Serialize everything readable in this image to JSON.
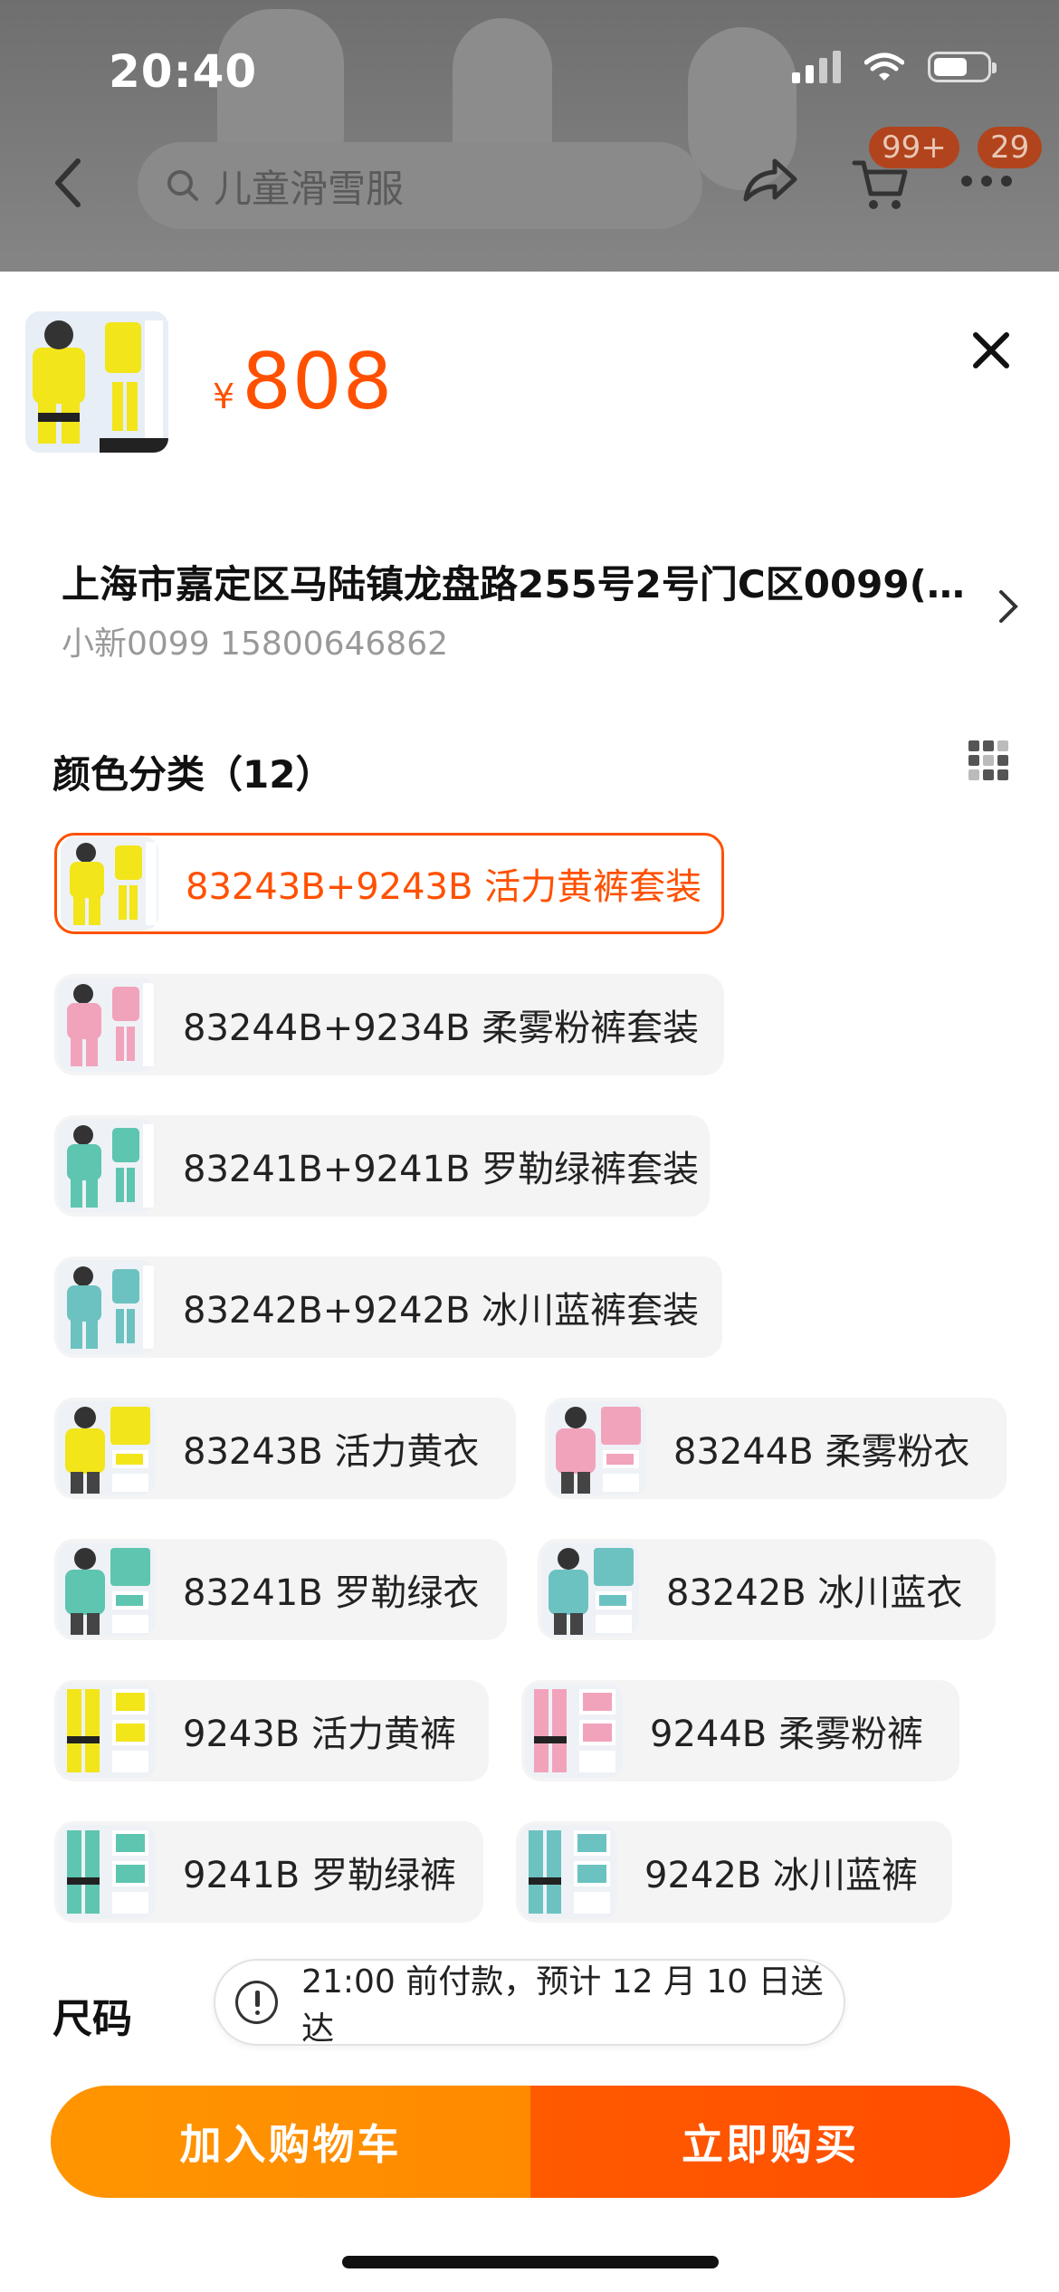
{
  "status_bar": {
    "time": "20:40"
  },
  "nav": {
    "search_placeholder": "儿童滑雪服",
    "cart_badge": "99+",
    "message_badge": "29",
    "icons": [
      "back-icon",
      "search-icon",
      "share-icon",
      "cart-icon",
      "more-icon"
    ]
  },
  "product": {
    "currency": "¥",
    "price": "808",
    "thumb_caption": "83243B+9243B"
  },
  "address": {
    "line": "上海市嘉定区马陆镇龙盘路255号2号门C区0099(...",
    "contact": "小新0099 15800646862"
  },
  "color_section": {
    "title": "颜色分类（12）",
    "options": [
      {
        "label": "83243B+9243B 活力黄裤套装",
        "selected": true,
        "swatch": "yellow-set"
      },
      {
        "label": "83244B+9234B 柔雾粉裤套装",
        "selected": false,
        "swatch": "pink-set"
      },
      {
        "label": "83241B+9241B 罗勒绿裤套装",
        "selected": false,
        "swatch": "green-set"
      },
      {
        "label": "83242B+9242B 冰川蓝裤套装",
        "selected": false,
        "swatch": "blue-set"
      },
      {
        "label": "83243B 活力黄衣",
        "selected": false,
        "swatch": "yellow-jacket"
      },
      {
        "label": "83244B 柔雾粉衣",
        "selected": false,
        "swatch": "pink-jacket"
      },
      {
        "label": "83241B 罗勒绿衣",
        "selected": false,
        "swatch": "green-jacket"
      },
      {
        "label": "83242B 冰川蓝衣",
        "selected": false,
        "swatch": "blue-jacket"
      },
      {
        "label": "9243B 活力黄裤",
        "selected": false,
        "swatch": "yellow-pants"
      },
      {
        "label": "9244B 柔雾粉裤",
        "selected": false,
        "swatch": "pink-pants"
      },
      {
        "label": "9241B 罗勒绿裤",
        "selected": false,
        "swatch": "green-pants"
      },
      {
        "label": "9242B 冰川蓝裤",
        "selected": false,
        "swatch": "blue-pants"
      }
    ]
  },
  "size_section": {
    "title": "尺码"
  },
  "delivery_tip": "21:00 前付款，预计 12 月 10 日送达",
  "actions": {
    "add_to_cart": "加入购物车",
    "buy_now": "立即购买"
  },
  "colors": {
    "accent": "#ff5000",
    "cart_btn": "#ff9000",
    "buy_btn": "#ff5000",
    "yellow": "#f2e51a",
    "pink": "#f2a3bc",
    "green": "#5ec5b0",
    "blue": "#6cc2c0"
  }
}
